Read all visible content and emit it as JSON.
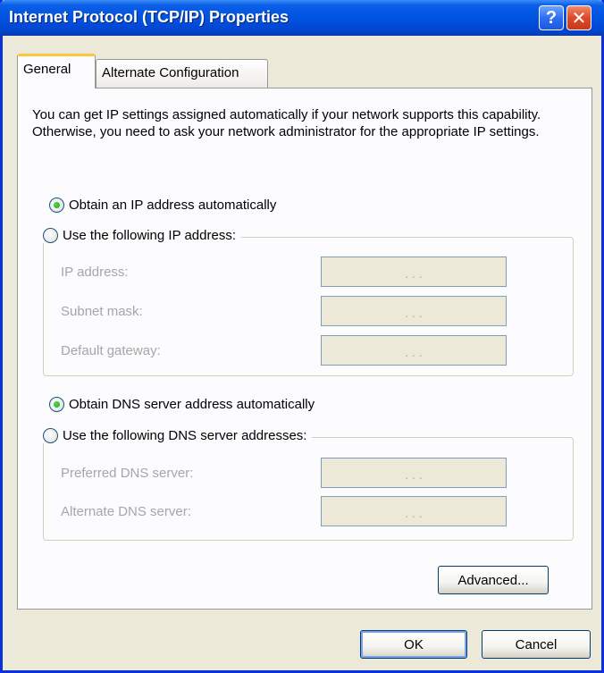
{
  "window": {
    "title": "Internet Protocol (TCP/IP) Properties",
    "help_icon": "?",
    "close_icon": "✕"
  },
  "tabs": [
    {
      "label": "General",
      "selected": true
    },
    {
      "label": "Alternate Configuration",
      "selected": false
    }
  ],
  "general": {
    "intro": "You can get IP settings assigned automatically if your network supports this capability. Otherwise, you need to ask your network administrator for the appropriate IP settings.",
    "ip": {
      "auto_label": "Obtain an IP address automatically",
      "manual_label": "Use the following IP address:",
      "selected": "auto",
      "fields": [
        {
          "label": "IP address:",
          "value": ". . ."
        },
        {
          "label": "Subnet mask:",
          "value": ". . ."
        },
        {
          "label": "Default gateway:",
          "value": ". . ."
        }
      ]
    },
    "dns": {
      "auto_label": "Obtain DNS server address automatically",
      "manual_label": "Use the following DNS server addresses:",
      "selected": "auto",
      "fields": [
        {
          "label": "Preferred DNS server:",
          "value": ". . ."
        },
        {
          "label": "Alternate DNS server:",
          "value": ". . ."
        }
      ]
    },
    "advanced_label": "Advanced..."
  },
  "footer": {
    "ok_label": "OK",
    "cancel_label": "Cancel"
  },
  "colors": {
    "titlebar": "#0054e3",
    "dialog_bg": "#ece9d8",
    "panel_bg": "#fcfcfe",
    "tab_highlight": "#ffc83c",
    "radio_checked": "#21a121"
  }
}
